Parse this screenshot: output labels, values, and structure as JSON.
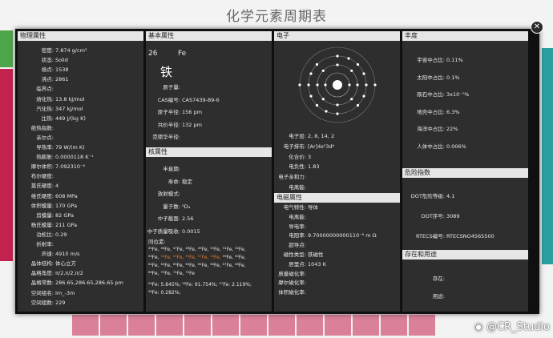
{
  "page": {
    "title": "化学元素周期表"
  },
  "icons": {
    "close": "close-icon",
    "weibo": "weibo-icon"
  },
  "colors": {
    "modal_bg": "#2e2e2e",
    "section_header": "#e6e6e6",
    "isotope_highlight": "#e07a2c"
  },
  "phys": {
    "header": "物理属性",
    "rows": [
      [
        "密度:",
        "7.874 g/cm³"
      ],
      [
        "状态:",
        "Solid"
      ],
      [
        "熔点:",
        "1538"
      ],
      [
        "沸点:",
        "2861"
      ],
      [
        "临界点:",
        ""
      ],
      [
        "熔化热:",
        "13.8 kJ/mol"
      ],
      [
        "汽化热:",
        "347 kJ/mol"
      ],
      [
        "比热:",
        "449 J/(kg K)"
      ],
      [
        "绝热指数:",
        ""
      ],
      [
        "亲尔点:",
        ""
      ],
      [
        "导热率:",
        "79 W/(m K)"
      ],
      [
        "热膨胀:",
        "0.0000118 K⁻¹"
      ],
      [
        "摩尔体积:",
        "7.092310⁻⁶"
      ],
      [
        "布尔硬度:",
        ""
      ],
      [
        "莫氏硬度:",
        "4"
      ],
      [
        "维氏硬度:",
        "608 MPa"
      ],
      [
        "体积模量:",
        "170 GPa"
      ],
      [
        "剪模量:",
        "82 GPa"
      ],
      [
        "杨氏模量:",
        "211 GPa"
      ],
      [
        "泊松比:",
        "0.29"
      ],
      [
        "折射率:",
        ""
      ],
      [
        "声速:",
        "4910 m/s"
      ],
      [
        "晶体结构:",
        "体心立方"
      ],
      [
        "晶格角度:",
        "π/2,π/2,π/2"
      ],
      [
        "晶格常数:",
        "286.65,286.65,286.65 pm"
      ],
      [
        "空间组名:",
        "Im_-3m"
      ],
      [
        "空间组数:",
        "229"
      ]
    ]
  },
  "basic": {
    "header": "基本属性",
    "number": "26",
    "symbol": "Fe",
    "name": "铁",
    "rows": [
      [
        "原子量:",
        ""
      ],
      [
        "CAS编号:",
        "CAS7439-89-6"
      ],
      [
        "原子半径:",
        "156 pm"
      ],
      [
        "共价半径:",
        "132 pm"
      ],
      [
        "范德华半径:",
        ""
      ]
    ]
  },
  "nuclear": {
    "header": "核属性",
    "rows": [
      [
        "半衰期:",
        ""
      ],
      [
        "寿命:",
        "稳定"
      ],
      [
        "放射模式:",
        ""
      ],
      [
        "量子数:",
        "⁵D₄"
      ],
      [
        "中子截面:",
        "2.56"
      ],
      [
        "中子质量吸收:",
        "0.0015"
      ]
    ],
    "iso_label": "同位素:",
    "iso_line1": "⁴⁵Fe, ⁴⁶Fe, ⁴⁷Fe, ⁴⁸Fe, ⁴⁹Fe, ⁵⁰Fe, ⁵¹Fe, ⁵²Fe,",
    "iso_line2a": "⁵³Fe, ",
    "iso_line2hi": "⁵⁴Fe, ⁵⁵Fe, ⁵⁶Fe, ⁵⁷Fe, ⁵⁸Fe,",
    "iso_line2b": " ⁵⁹Fe, ⁶⁰Fe,",
    "iso_line3": "⁶¹Fe, ⁶²Fe, ⁶³Fe, ⁶⁴Fe, ⁶⁵Fe, ⁶⁶Fe, ⁶⁷Fe, ⁶⁸Fe,",
    "iso_line4": "⁶⁹Fe, ⁷⁰Fe, ⁷¹Fe, ⁷²Fe",
    "iso_line5": "⁵⁴Fe: 5.845%; ⁵⁶Fe: 91.754%; ⁵⁷Fe: 2.119%;",
    "iso_line6": "⁵⁸Fe: 0.282%;"
  },
  "electron": {
    "header": "电子",
    "rows": [
      [
        "电子层:",
        "2, 8, 14, 2"
      ],
      [
        "电子排布:",
        "[Ar]4s²3d⁶"
      ],
      [
        "化合价:",
        "3"
      ],
      [
        "电负性:",
        "1.83"
      ],
      [
        "电子亲和力:",
        ""
      ],
      [
        "电离能:",
        ""
      ]
    ]
  },
  "em": {
    "header": "电磁属性",
    "rows": [
      [
        "电气特性:",
        "导体"
      ],
      [
        "电离能:",
        ""
      ],
      [
        "导电率:",
        ""
      ],
      [
        "电阻率:",
        "9.70000000000110⁻⁸ m Ω"
      ],
      [
        "超导点:",
        ""
      ],
      [
        "磁性类型:",
        "铁磁性"
      ],
      [
        "居里点:",
        "1043 K"
      ],
      [
        "质量磁化率:",
        ""
      ],
      [
        "摩尔磁化率:",
        ""
      ],
      [
        "体积磁化率:",
        ""
      ]
    ]
  },
  "abund": {
    "header": "丰度",
    "rows": [
      [
        "宇宙中占比:",
        "0.11%"
      ],
      [
        "太阳中占比:",
        "0.1%"
      ],
      [
        "陨石中占比:",
        "3x10⁻⁷%"
      ],
      [
        "地壳中占比:",
        "6.3%"
      ],
      [
        "海洋中占比:",
        "22%"
      ],
      [
        "人体中占比:",
        "0.006%"
      ]
    ]
  },
  "hazard": {
    "header": "危险指数",
    "rows": [
      [
        "DOT危险等级:",
        "4.1"
      ],
      [
        "DOT序号:",
        "3089"
      ],
      [
        "RTECS编号:",
        "RTECSNO4565500"
      ]
    ]
  },
  "use": {
    "header": "存在和用途",
    "rows": [
      [
        "存在:",
        ""
      ],
      [
        "用途:",
        ""
      ]
    ]
  },
  "watermark": {
    "text": "@CR_Studio"
  }
}
